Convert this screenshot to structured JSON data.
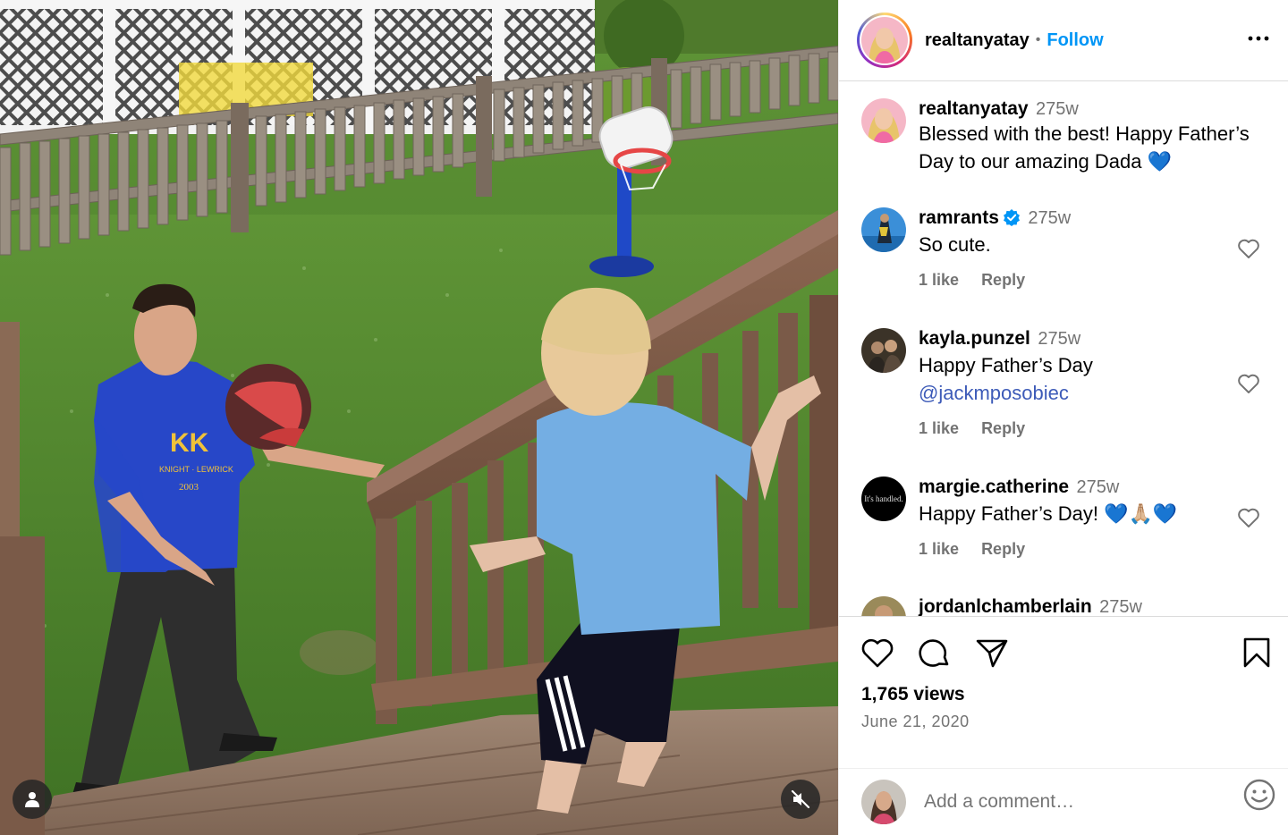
{
  "post": {
    "author": "realtanyatay",
    "separator": "•",
    "follow_label": "Follow",
    "caption_author": "realtanyatay",
    "caption_time": "275w",
    "caption_text": "Blessed with the best! Happy Father’s Day to our amazing Dada 💙",
    "views": "1,765 views",
    "date": "June 21, 2020"
  },
  "comments": [
    {
      "user": "ramrants",
      "verified": true,
      "time": "275w",
      "text": "So cute.",
      "likes": "1 like",
      "reply": "Reply"
    },
    {
      "user": "kayla.punzel",
      "verified": false,
      "time": "275w",
      "text": "Happy Father’s Day",
      "mention": "@jackmposobiec",
      "likes": "1 like",
      "reply": "Reply"
    },
    {
      "user": "margie.catherine",
      "verified": false,
      "time": "275w",
      "text": "Happy Father’s Day! 💙🙏🏼💙",
      "avatar_text": "It's handled.",
      "likes": "1 like",
      "reply": "Reply"
    },
    {
      "user": "jordanlchamberlain",
      "verified": false,
      "time": "275w"
    }
  ],
  "add_comment": {
    "placeholder": "Add a comment…"
  },
  "colors": {
    "accent": "#0095f6",
    "muted": "#737373",
    "divider": "#dbdbdb"
  },
  "icons": [
    "more-icon",
    "heart-icon",
    "comment-icon",
    "share-icon",
    "save-icon",
    "emoji-icon",
    "user-tag-icon",
    "mute-icon",
    "verified-icon"
  ],
  "media": {
    "shirt_text": "KK",
    "shirt_subtext": "KNIGHT · LEWRICK · ... 2003"
  }
}
